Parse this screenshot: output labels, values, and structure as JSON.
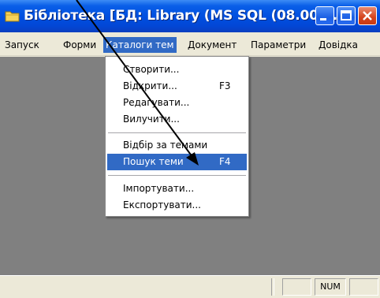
{
  "window": {
    "title": "Бібліотека [БД: Library (MS SQL (08.00.0..."
  },
  "menubar": {
    "items": [
      {
        "label": "Запуск"
      },
      {
        "label": "Форми"
      },
      {
        "label": "Каталоги тем",
        "active": true
      },
      {
        "label": "Документ"
      },
      {
        "label": "Параметри"
      },
      {
        "label": "Довідка"
      }
    ]
  },
  "dropdown": {
    "items": [
      {
        "label": "Створити...",
        "shortcut": ""
      },
      {
        "label": "Відкрити...",
        "shortcut": "F3"
      },
      {
        "label": "Редагувати...",
        "shortcut": ""
      },
      {
        "label": "Вилучити...",
        "shortcut": ""
      },
      {
        "label": "Відбір за темами",
        "shortcut": ""
      },
      {
        "label": "Пошук теми",
        "shortcut": "F4",
        "highlighted": true
      },
      {
        "label": "Імпортувати...",
        "shortcut": ""
      },
      {
        "label": "Експортувати...",
        "shortcut": ""
      }
    ]
  },
  "statusbar": {
    "num_label": "NUM"
  },
  "colors": {
    "titlebar": "#0050e0",
    "menu_highlight": "#316ac5",
    "client_bg": "#808080",
    "chrome_bg": "#ece9d8"
  },
  "icons": {
    "app": "folder-icon",
    "minimize": "minimize-icon",
    "maximize": "maximize-icon",
    "close": "close-icon"
  }
}
